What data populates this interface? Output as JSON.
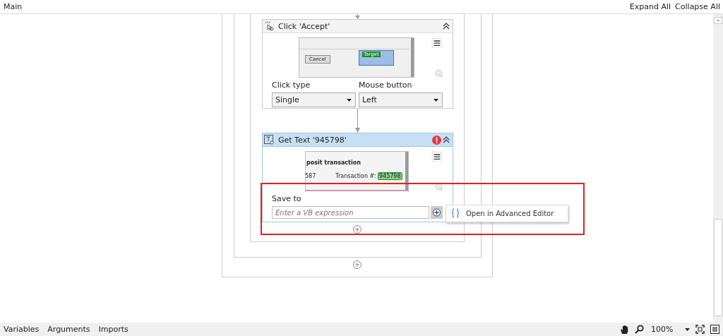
{
  "top_bar": {
    "title": "Main",
    "actions": [
      "Expand All",
      "Collapse All"
    ]
  },
  "activities": [
    {
      "kind": "click",
      "title": "Click 'Accept'",
      "error": false,
      "preview": {
        "button": "Cancel",
        "target": "Target"
      },
      "fields": [
        {
          "label": "Click type",
          "value": "Single"
        },
        {
          "label": "Mouse button",
          "value": "Left"
        }
      ]
    },
    {
      "kind": "get_text",
      "title": "Get Text '945798'",
      "error": true,
      "preview": {
        "heading": "posit transaction",
        "number": "587",
        "label": "Transaction #:",
        "value": "945798"
      },
      "save_to": {
        "label": "Save to",
        "placeholder": "Enter a VB expression"
      }
    }
  ],
  "context_menu": {
    "items": [
      "Open in Advanced Editor"
    ]
  },
  "bottom_bar": {
    "tabs": [
      "Variables",
      "Arguments",
      "Imports"
    ],
    "zoom": "100%"
  }
}
